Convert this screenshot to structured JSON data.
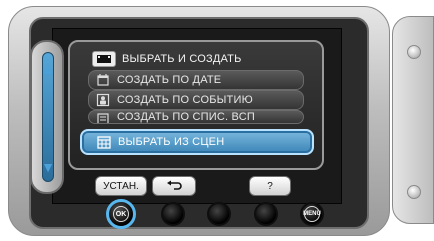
{
  "menu": {
    "title": "ВЫБРАТЬ И СОЗДАТЬ",
    "items": [
      "СОЗДАТЬ ПО ДАТЕ",
      "СОЗДАТЬ ПО СОБЫТИЮ",
      "СОЗДАТЬ ПО СПИС. ВСП",
      "ВЫБРАТЬ ИЗ СЦЕН"
    ],
    "selected_index": 3
  },
  "buttons": {
    "set": "УСТАН.",
    "back_icon": "return-arrow-icon",
    "help": "?",
    "ok": "OK",
    "menu": "MENU"
  },
  "colors": {
    "highlight": "#4a95c8",
    "ok_ring": "#59b7ef"
  }
}
